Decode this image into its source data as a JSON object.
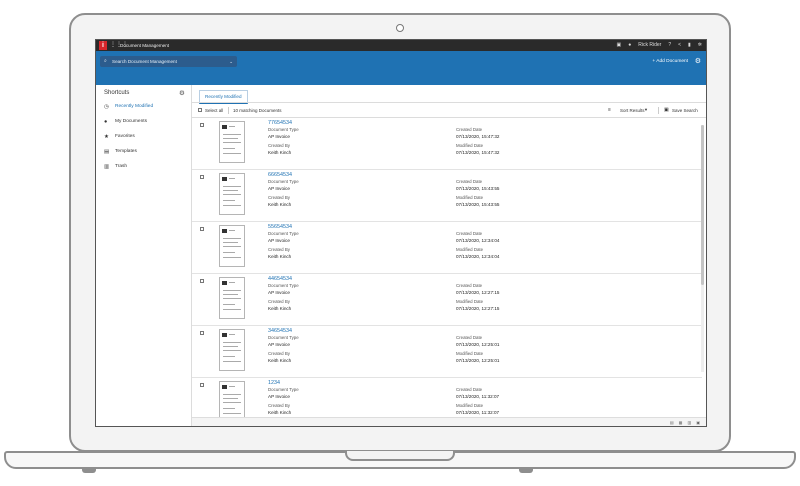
{
  "topbar": {
    "logo": "i",
    "app_title": "Document Management",
    "user_name": "Rick Rider"
  },
  "header": {
    "search_placeholder": "Search Document Management",
    "add_document_label": "+ Add Document"
  },
  "sidebar": {
    "title": "Shortcuts",
    "items": [
      {
        "label": "Recently Modified",
        "icon": "clock-icon"
      },
      {
        "label": "My Documents",
        "icon": "user-icon"
      },
      {
        "label": "Favorites",
        "icon": "star-icon"
      },
      {
        "label": "Templates",
        "icon": "template-icon"
      },
      {
        "label": "Trash",
        "icon": "trash-icon"
      }
    ]
  },
  "main": {
    "tab_label": "Recently Modified",
    "select_all_label": "Select all",
    "matching_count": "10 matching Documents",
    "sort_label": "Sort Results",
    "save_search_label": "Save Search"
  },
  "labels": {
    "document_type": "Document Type",
    "created_by": "Created By",
    "created_date": "Created Date",
    "modified_date": "Modified Date"
  },
  "documents": [
    {
      "id": "77654534",
      "type": "AP Invoice",
      "created_by": "Keith Kinch",
      "created_date": "07/13/2020, 15:47:32",
      "modified_date": "07/13/2020, 15:47:32"
    },
    {
      "id": "66654534",
      "type": "AP Invoice",
      "created_by": "Keith Kinch",
      "created_date": "07/13/2020, 15:43:55",
      "modified_date": "07/13/2020, 15:43:55"
    },
    {
      "id": "55654534",
      "type": "AP Invoice",
      "created_by": "Keith Kinch",
      "created_date": "07/13/2020, 12:34:04",
      "modified_date": "07/13/2020, 12:34:04"
    },
    {
      "id": "44654534",
      "type": "AP Invoice",
      "created_by": "Keith Kinch",
      "created_date": "07/13/2020, 12:27:15",
      "modified_date": "07/13/2020, 12:27:15"
    },
    {
      "id": "34654534",
      "type": "AP Invoice",
      "created_by": "Keith Kinch",
      "created_date": "07/13/2020, 12:25:01",
      "modified_date": "07/13/2020, 12:25:01"
    },
    {
      "id": "1234",
      "type": "AP Invoice",
      "created_by": "Keith Kinch",
      "created_date": "07/13/2020, 11:32:07",
      "modified_date": "07/13/2020, 11:32:07"
    }
  ],
  "colors": {
    "brand_red": "#d8262b",
    "header_blue": "#1f72b3",
    "topbar_dark": "#2a2a2a"
  }
}
